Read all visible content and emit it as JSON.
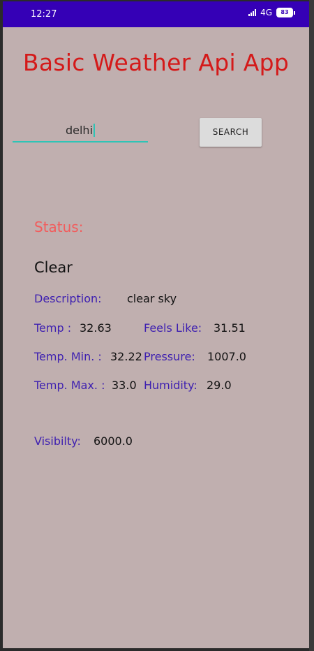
{
  "status_bar": {
    "time": "12:27",
    "network": "4G",
    "battery": "83"
  },
  "app": {
    "title": "Basic Weather Api App"
  },
  "search": {
    "value": "delhi",
    "button_label": "SEARCH"
  },
  "weather": {
    "status_label": "Status:",
    "status_value": "Clear",
    "description_label": "Description:",
    "description_value": "clear sky",
    "temp_label": "Temp :",
    "temp_value": "32.63",
    "feels_like_label": "Feels Like:",
    "feels_like_value": "31.51",
    "temp_min_label": "Temp. Min. :",
    "temp_min_value": "32.22",
    "pressure_label": "Pressure:",
    "pressure_value": "1007.0",
    "temp_max_label": "Temp. Max. :",
    "temp_max_value": "33.0",
    "humidity_label": "Humidity:",
    "humidity_value": "29.0",
    "visibility_label": "Visibilty:",
    "visibility_value": "6000.0"
  },
  "colors": {
    "status_bar": "#3500b6",
    "background": "#c0afaf",
    "title": "#d41a1a",
    "status_label": "#f25c5c",
    "field_label": "#3d1fb0",
    "accent": "#2ec4b6"
  }
}
